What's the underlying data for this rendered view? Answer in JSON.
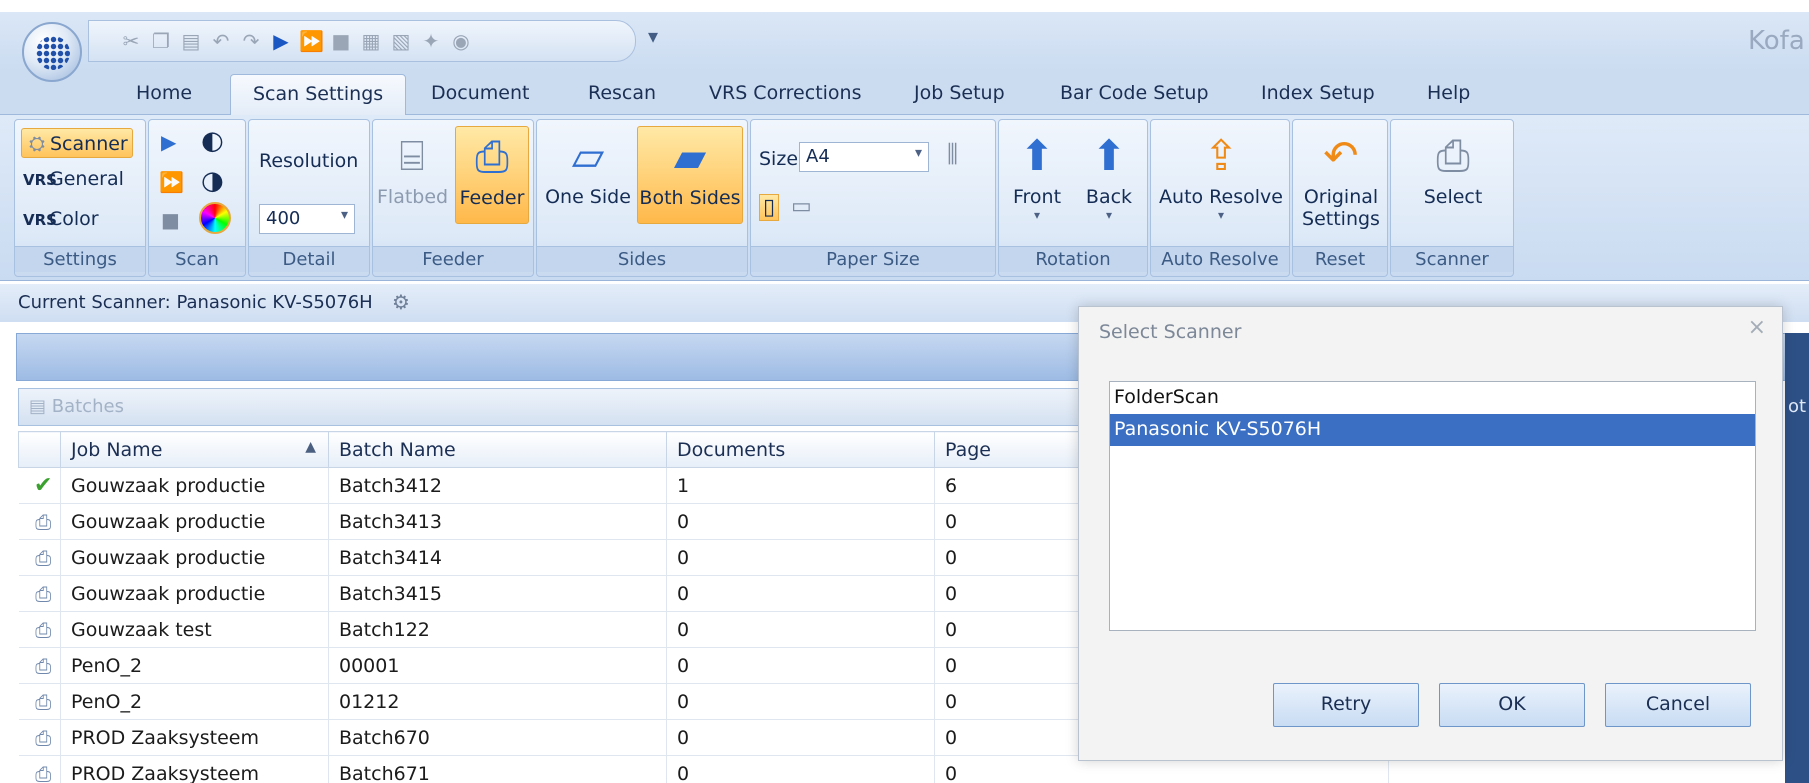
{
  "title_bar": {
    "app_title": "Kofa",
    "quick_access": [
      "cut-icon",
      "copy-icon",
      "paste-icon",
      "undo-icon",
      "redo-icon",
      "play-icon",
      "fast-forward-icon",
      "stop-icon",
      "scanner-import-icon",
      "scanner-export-icon",
      "satellite-icon",
      "help-circle-icon"
    ],
    "more_glyph": "▾"
  },
  "tabs": [
    "Home",
    "Scan Settings",
    "Document",
    "Rescan",
    "VRS Corrections",
    "Job Setup",
    "Bar Code Setup",
    "Index Setup",
    "Help"
  ],
  "active_tab": "Scan Settings",
  "ribbon": {
    "settings": {
      "scanner": "Scanner",
      "general": "General",
      "color": "Color",
      "label": "Settings"
    },
    "scan": {
      "label": "Scan"
    },
    "detail": {
      "resolution_label": "Resolution",
      "resolution_value": "400",
      "label": "Detail"
    },
    "feeder": {
      "flatbed": "Flatbed",
      "feeder": "Feeder",
      "label": "Feeder"
    },
    "sides": {
      "one_side": "One Side",
      "both_sides": "Both Sides",
      "label": "Sides"
    },
    "paper_size": {
      "size_label": "Size",
      "size_value": "A4",
      "label": "Paper Size"
    },
    "rotation": {
      "front": "Front",
      "back": "Back",
      "label": "Rotation"
    },
    "auto_resolve": {
      "button": "Auto Resolve",
      "label": "Auto Resolve"
    },
    "reset": {
      "button_line1": "Original",
      "button_line2": "Settings",
      "label": "Reset"
    },
    "scanner_group": {
      "button": "Select",
      "label": "Scanner"
    }
  },
  "current_scanner": "Current Scanner: Panasonic KV-S5076H",
  "batches_panel": {
    "title": "Batches",
    "columns": [
      "Job Name",
      "Batch Name",
      "Documents",
      "Page"
    ],
    "rows": [
      {
        "status": "complete",
        "job": "Gouwzaak productie",
        "batch": "Batch3412",
        "docs": "1",
        "pages": "6"
      },
      {
        "status": "scan",
        "job": "Gouwzaak productie",
        "batch": "Batch3413",
        "docs": "0",
        "pages": "0"
      },
      {
        "status": "scan",
        "job": "Gouwzaak productie",
        "batch": "Batch3414",
        "docs": "0",
        "pages": "0"
      },
      {
        "status": "scan",
        "job": "Gouwzaak productie",
        "batch": "Batch3415",
        "docs": "0",
        "pages": "0"
      },
      {
        "status": "scan",
        "job": "Gouwzaak test",
        "batch": "Batch122",
        "docs": "0",
        "pages": "0"
      },
      {
        "status": "scan",
        "job": "PenO_2",
        "batch": "00001",
        "docs": "0",
        "pages": "0"
      },
      {
        "status": "scan",
        "job": "PenO_2",
        "batch": "01212",
        "docs": "0",
        "pages": "0"
      },
      {
        "status": "scan",
        "job": "PROD Zaaksysteem",
        "batch": "Batch670",
        "docs": "0",
        "pages": "0"
      },
      {
        "status": "scan",
        "job": "PROD Zaaksysteem",
        "batch": "Batch671",
        "docs": "0",
        "pages": "0"
      }
    ]
  },
  "right_panel_cut_label": "ot",
  "dialog": {
    "title": "Select Scanner",
    "close": "×",
    "options": [
      "FolderScan",
      "Panasonic KV-S5076H"
    ],
    "selected": "Panasonic KV-S5076H",
    "retry": "Retry",
    "ok": "OK",
    "cancel": "Cancel"
  }
}
